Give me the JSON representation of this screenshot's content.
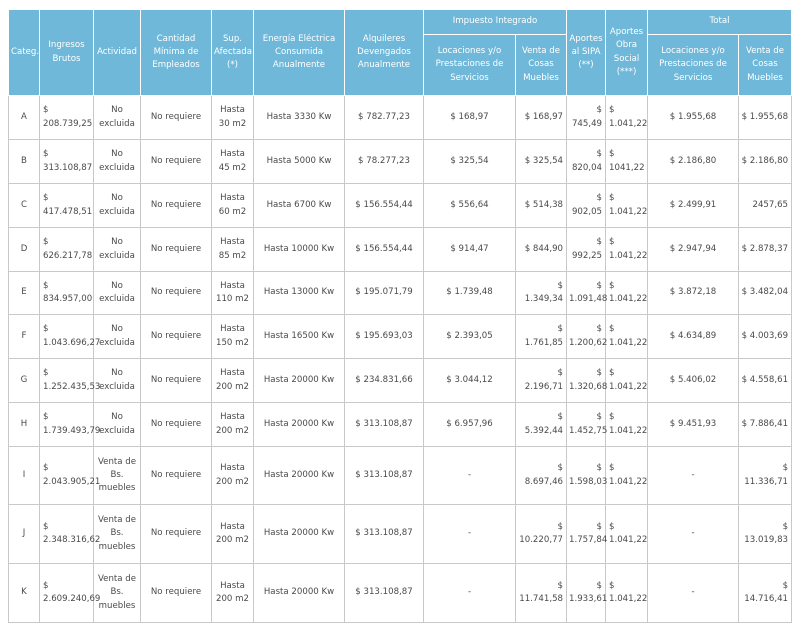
{
  "headers": {
    "categ": "Categ.",
    "ingresos": "Ingresos Brutos",
    "actividad": "Actividad",
    "empleados": "Cantidad Mínima de Empleados",
    "superficie": "Sup. Afectada (*)",
    "energia": "Energía Eléctrica Consumida Anualmente",
    "alquileres": "Alquileres Devengados Anualmente",
    "impuesto": "Impuesto Integrado",
    "sipa": "Aportes al SIPA (**)",
    "obra_social": "Aportes Obra Social (***)",
    "total": "Total",
    "locaciones": "Locaciones y/o Prestaciones de Servicios",
    "venta": "Venta de Cosas Muebles"
  },
  "rows": [
    {
      "cat": "A",
      "ingresos": "$ 208.739,25",
      "actividad": "No excluida",
      "empleados": "No requiere",
      "sup": "Hasta 30 m2",
      "energia": "Hasta 3330 Kw",
      "alquileres": "$ 782.77,23",
      "imp_loc": "$ 168,97",
      "imp_venta": "$ 168,97",
      "sipa": "$ 745,49",
      "obra": "$ 1.041,22",
      "tot_loc": "$ 1.955,68",
      "tot_venta": "$ 1.955,68"
    },
    {
      "cat": "B",
      "ingresos": "$ 313.108,87",
      "actividad": "No excluida",
      "empleados": "No requiere",
      "sup": "Hasta 45 m2",
      "energia": "Hasta 5000 Kw",
      "alquileres": "$ 78.277,23",
      "imp_loc": "$ 325,54",
      "imp_venta": "$ 325,54",
      "sipa": "$ 820,04",
      "obra": "$ 1041,22",
      "tot_loc": "$ 2.186,80",
      "tot_venta": "$ 2.186,80"
    },
    {
      "cat": "C",
      "ingresos": "$ 417.478,51",
      "actividad": "No excluida",
      "empleados": "No requiere",
      "sup": "Hasta 60 m2",
      "energia": "Hasta 6700 Kw",
      "alquileres": "$ 156.554,44",
      "imp_loc": "$ 556,64",
      "imp_venta": "$ 514,38",
      "sipa": "$ 902,05",
      "obra": "$ 1.041,22",
      "tot_loc": "$ 2.499,91",
      "tot_venta": "2457,65"
    },
    {
      "cat": "D",
      "ingresos": "$ 626.217,78",
      "actividad": "No excluida",
      "empleados": "No requiere",
      "sup": "Hasta 85 m2",
      "energia": "Hasta 10000 Kw",
      "alquileres": "$ 156.554,44",
      "imp_loc": "$ 914,47",
      "imp_venta": "$ 844,90",
      "sipa": "$ 992,25",
      "obra": "$ 1.041,22",
      "tot_loc": "$ 2.947,94",
      "tot_venta": "$ 2.878,37"
    },
    {
      "cat": "E",
      "ingresos": "$ 834.957,00",
      "actividad": "No excluida",
      "empleados": "No requiere",
      "sup": "Hasta 110 m2",
      "energia": "Hasta 13000 Kw",
      "alquileres": "$ 195.071,79",
      "imp_loc": "$ 1.739,48",
      "imp_venta": "$ 1.349,34",
      "sipa": "$ 1.091,48",
      "obra": "$ 1.041,22",
      "tot_loc": "$ 3.872,18",
      "tot_venta": "$ 3.482,04"
    },
    {
      "cat": "F",
      "ingresos": "$ 1.043.696,27",
      "actividad": "No excluida",
      "empleados": "No requiere",
      "sup": "Hasta 150 m2",
      "energia": "Hasta 16500 Kw",
      "alquileres": "$ 195.693,03",
      "imp_loc": "$ 2.393,05",
      "imp_venta": "$ 1.761,85",
      "sipa": "$ 1.200,62",
      "obra": "$ 1.041,22",
      "tot_loc": "$ 4.634,89",
      "tot_venta": "$ 4.003,69"
    },
    {
      "cat": "G",
      "ingresos": "$ 1.252.435,53",
      "actividad": "No excluida",
      "empleados": "No requiere",
      "sup": "Hasta 200 m2",
      "energia": "Hasta 20000 Kw",
      "alquileres": "$ 234.831,66",
      "imp_loc": "$ 3.044,12",
      "imp_venta": "$ 2.196,71",
      "sipa": "$ 1.320,68",
      "obra": "$ 1.041,22",
      "tot_loc": "$ 5.406,02",
      "tot_venta": "$ 4.558,61"
    },
    {
      "cat": "H",
      "ingresos": "$ 1.739.493,79",
      "actividad": "No excluida",
      "empleados": "No requiere",
      "sup": "Hasta 200 m2",
      "energia": "Hasta 20000 Kw",
      "alquileres": "$ 313.108,87",
      "imp_loc": "$ 6.957,96",
      "imp_venta": "$ 5.392,44",
      "sipa": "$ 1.452,75",
      "obra": "$ 1.041,22",
      "tot_loc": "$ 9.451,93",
      "tot_venta": "$ 7.886,41"
    },
    {
      "cat": "I",
      "ingresos": "$ 2.043.905,21",
      "actividad": "Venta de Bs. muebles",
      "empleados": "No requiere",
      "sup": "Hasta 200 m2",
      "energia": "Hasta 20000 Kw",
      "alquileres": "$ 313.108,87",
      "imp_loc": "-",
      "imp_venta": "$ 8.697,46",
      "sipa": "$ 1.598,03",
      "obra": "$ 1.041,22",
      "tot_loc": "-",
      "tot_venta": "$ 11.336,71"
    },
    {
      "cat": "J",
      "ingresos": "$ 2.348.316,62",
      "actividad": "Venta de Bs. muebles",
      "empleados": "No requiere",
      "sup": "Hasta 200 m2",
      "energia": "Hasta 20000 Kw",
      "alquileres": "$ 313.108,87",
      "imp_loc": "-",
      "imp_venta": "$ 10.220,77",
      "sipa": "$ 1.757,84",
      "obra": "$ 1.041,22",
      "tot_loc": "-",
      "tot_venta": "$ 13.019,83"
    },
    {
      "cat": "K",
      "ingresos": "$ 2.609.240,69",
      "actividad": "Venta de Bs. muebles",
      "empleados": "No requiere",
      "sup": "Hasta 200 m2",
      "energia": "Hasta 20000 Kw",
      "alquileres": "$ 313.108,87",
      "imp_loc": "-",
      "imp_venta": "$ 11.741,58",
      "sipa": "$ 1.933,61",
      "obra": "$ 1.041,22",
      "tot_loc": "-",
      "tot_venta": "$ 14.716,41"
    }
  ]
}
